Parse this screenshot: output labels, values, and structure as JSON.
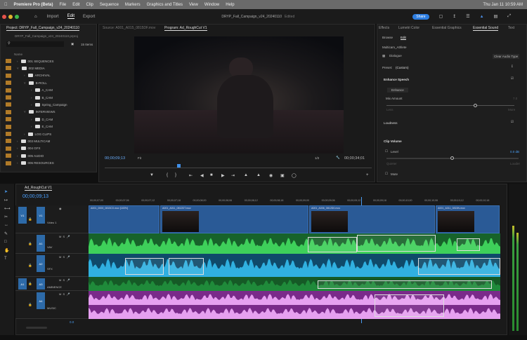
{
  "menubar": {
    "app": "Premiere Pro (Beta)",
    "items": [
      "File",
      "Edit",
      "Clip",
      "Sequence",
      "Markers",
      "Graphics and Titles",
      "View",
      "Window",
      "Help"
    ],
    "clock": "Thu Jan 11  10:59 AM"
  },
  "header": {
    "nav": [
      "Import",
      "Edit",
      "Export"
    ],
    "active": "Edit",
    "title": "DRYP_Fall_Campaign_v24_20240110",
    "status": "Edited",
    "share": "Share"
  },
  "project": {
    "tab": "Project: DRYP_Fall_Campaign_v24_20240110",
    "file": "DRYP_Fall_Campaign_v24_20240110.prproj",
    "items_count": "15 Items",
    "column": "Name",
    "tree": [
      {
        "name": "001 SEQUENCES",
        "depth": 0
      },
      {
        "name": "002 MEDIA",
        "depth": 0,
        "open": true
      },
      {
        "name": "ARCHIVAL",
        "depth": 1
      },
      {
        "name": "B-ROLL",
        "depth": 1,
        "open": true
      },
      {
        "name": "A_CAM",
        "depth": 2
      },
      {
        "name": "B_CAM",
        "depth": 2
      },
      {
        "name": "Spring_Campaign",
        "depth": 2
      },
      {
        "name": "INTERVIEWS",
        "depth": 1,
        "open": true
      },
      {
        "name": "D_CAM",
        "depth": 2
      },
      {
        "name": "E_CAM",
        "depth": 2
      },
      {
        "name": "LOG CLIPS",
        "depth": 1
      },
      {
        "name": "003 MULTICAM",
        "depth": 0
      },
      {
        "name": "004 GFX",
        "depth": 0
      },
      {
        "name": "005 AUDIO",
        "depth": 0
      },
      {
        "name": "006 RESOURCES",
        "depth": 0
      }
    ]
  },
  "source": {
    "tab": "Source: A001_A015_0815DF.mov"
  },
  "program": {
    "tab": "Program: Ad_RoughCut V1",
    "timecode": "00;00;09;13",
    "fit": "Fit",
    "quality": "1/2",
    "duration": "00;00;34;01"
  },
  "right": {
    "tabs": [
      "Effects",
      "Lumetri Color",
      "Essential Graphics",
      "Essential Sound",
      "Text"
    ],
    "active": "Essential Sound",
    "subtabs": [
      "Browse",
      "Edit"
    ],
    "clip": "Multicam_Athlete",
    "type": "Dialogue",
    "clear": "Clear Audio Type",
    "preset_label": "Preset:",
    "preset": "(Custom)",
    "enhance": {
      "title": "Enhance Speech",
      "button": "Enhance",
      "mix": "Mix Amount",
      "mix_value": "7.0",
      "low": "Less",
      "high": "More",
      "level": 0.7
    },
    "loudness": "Loudness",
    "clip_volume": "Clip Volume",
    "level_label": "Level",
    "level_value": "0.0 dB",
    "quieter": "Quieter",
    "louder": "Louder",
    "volume": 0.5,
    "mute": "Mute"
  },
  "timeline": {
    "tab": "Ad_RoughCut V1",
    "timecode": "00;00;09;13",
    "ticks": [
      "00;00;07;00",
      "00;00;07;06",
      "00;00;07;12",
      "00;00;07;18",
      "00;00;08;00",
      "00;00;08;06",
      "00;00;08;12",
      "00;00;08;18",
      "00;00;09;00",
      "00;00;09;06",
      "00;00;09;12",
      "00;00;09;18",
      "00;00;10;00",
      "00;00;10;06",
      "00;00;10;12",
      "00;00;10;18"
    ],
    "tracks": [
      {
        "id": "V1",
        "name": "Video 1"
      },
      {
        "id": "A1",
        "name": "VAV"
      },
      {
        "id": "A2",
        "name": "SFX"
      },
      {
        "id": "A3",
        "name": "AMBIENCE"
      },
      {
        "id": "A4",
        "name": "MUSIC"
      }
    ],
    "clips": [
      "A001_0000_0815C0.mov [183%]",
      "A001_A011_0812DT.mov",
      "A001_A006_0812D0.mov",
      "A001_A011_0815N.mov"
    ],
    "zoom": "0.0"
  },
  "colors": {
    "video": "#2a5a96",
    "dialogue": "#1f8a3a",
    "sfx": "#1e6f9a",
    "music": "#c070d0",
    "accent": "#2d8ceb"
  }
}
